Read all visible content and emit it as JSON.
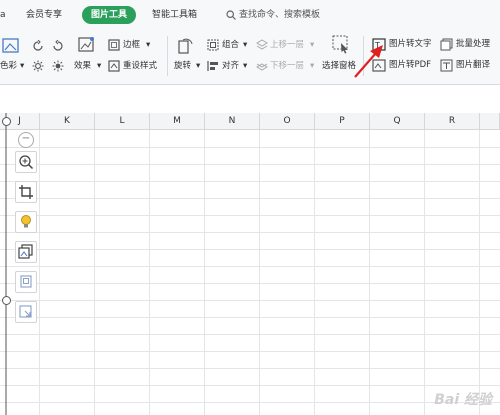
{
  "tabs": [
    {
      "label": "a"
    },
    {
      "label": "会员专享"
    },
    {
      "label": "图片工具"
    },
    {
      "label": "智能工具箱"
    }
  ],
  "search": {
    "placeholder": "查找命令、搜索模板"
  },
  "ribbon": {
    "color_label": "色彩",
    "effect_label": "效果",
    "border_label": "边框",
    "reset_label": "重设样式",
    "rotate_label": "旋转",
    "group_label": "组合",
    "align_label": "对齐",
    "move_up_label": "上移一层",
    "move_down_label": "下移一层",
    "select_pane_label": "选择窗格",
    "pic_to_text_label": "图片转文字",
    "batch_label": "批量处理",
    "pic_to_pdf_label": "图片转PDF",
    "pic_translate_label": "图片翻译"
  },
  "columns": [
    "J",
    "K",
    "L",
    "M",
    "N",
    "O",
    "P",
    "Q",
    "R"
  ],
  "sidebar_tools": [
    "zoom-in-icon",
    "crop-icon",
    "lightbulb-icon",
    "copy-image-icon",
    "layers-icon",
    "image-select-icon"
  ],
  "colors": {
    "accent": "#2aa05c",
    "arrow": "#e02020"
  },
  "watermark": "Bai 经验"
}
